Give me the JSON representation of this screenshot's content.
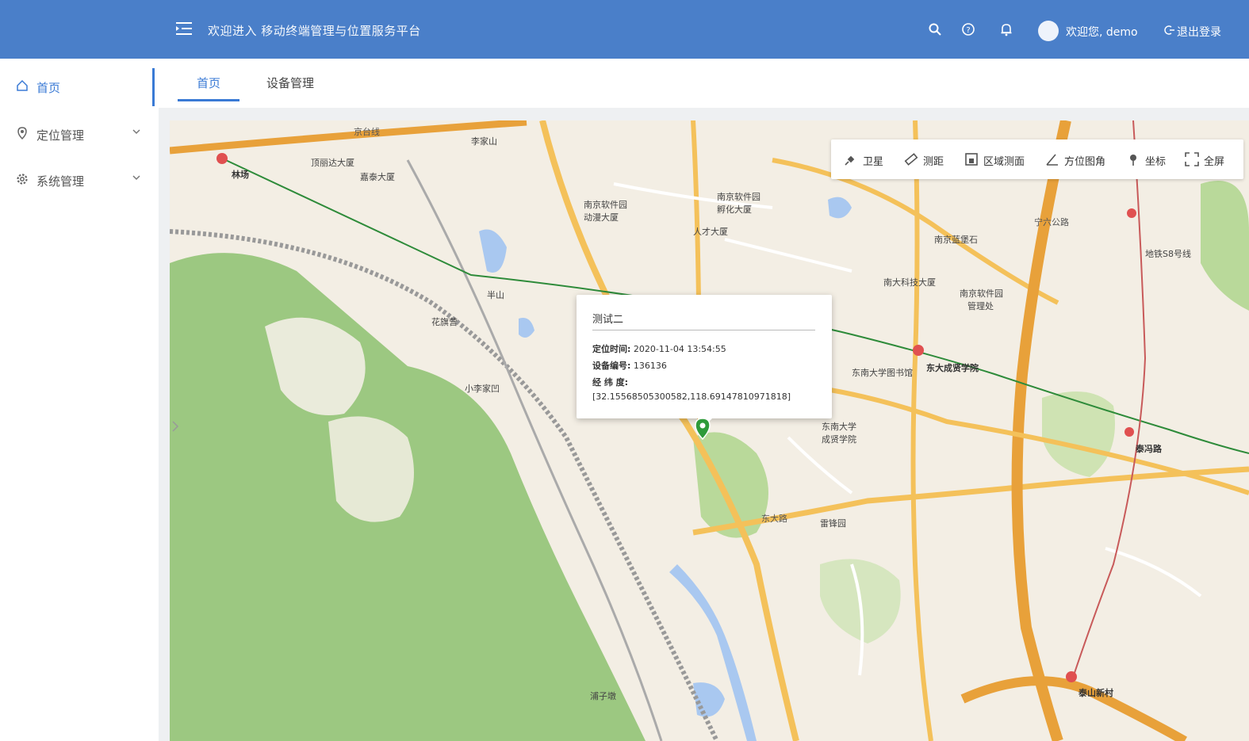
{
  "header": {
    "welcome": "欢迎进入 移动终端管理与位置服务平台",
    "user_greeting": "欢迎您, demo",
    "logout_label": "退出登录",
    "accent_color": "#4a7fc9",
    "icons": [
      "menu-fold-icon",
      "search-icon",
      "help-icon",
      "bell-icon",
      "avatar",
      "logout-icon"
    ]
  },
  "sidebar": {
    "items": [
      {
        "label": "首页",
        "icon": "home-icon",
        "active": true
      },
      {
        "label": "定位管理",
        "icon": "location-icon",
        "expandable": true
      },
      {
        "label": "系统管理",
        "icon": "gear-icon",
        "expandable": true
      }
    ]
  },
  "tabs": [
    {
      "label": "首页",
      "active": true
    },
    {
      "label": "设备管理",
      "active": false
    }
  ],
  "toolbar": {
    "items": [
      {
        "label": "卫星",
        "icon": "satellite-icon"
      },
      {
        "label": "测距",
        "icon": "ruler-icon"
      },
      {
        "label": "区域测面",
        "icon": "area-icon"
      },
      {
        "label": "方位图角",
        "icon": "angle-icon"
      },
      {
        "label": "坐标",
        "icon": "pin-icon"
      },
      {
        "label": "全屏",
        "icon": "fullscreen-icon"
      }
    ]
  },
  "popup": {
    "title": "测试二",
    "time_label": "定位时间:",
    "time_value": "2020-11-04 13:54:55",
    "device_label": "设备编号:",
    "device_value": "136136",
    "coord_label": "经 纬 度:",
    "coord_value": "[32.15568505300582,118.69147810971818]"
  },
  "map": {
    "labels": [
      "京台线",
      "林场",
      "顶丽达大厦",
      "嘉泰大厦",
      "李家山",
      "南京软件园",
      "动漫大厦",
      "南京软件园",
      "孵化大厦",
      "人才大厦",
      "南京蓝堡石",
      "南大科技大厦",
      "南京软件园",
      "管理处",
      "东大成贤学院",
      "地铁S8号线",
      "泰冯路",
      "东南大学图书馆",
      "东南大学",
      "成贤学院",
      "宁六公路",
      "东大路",
      "泰山新村",
      "半山",
      "小李家凹",
      "花旗营",
      "浦子墩",
      "雷锋园"
    ],
    "colors": {
      "land": "#f3eee4",
      "park": "#9cc881",
      "road_major": "#f4c15a",
      "road_minor": "#ffffff",
      "highway": "#e8a13a",
      "water": "#a9c8f0",
      "metro": "#2e8b3a"
    }
  }
}
